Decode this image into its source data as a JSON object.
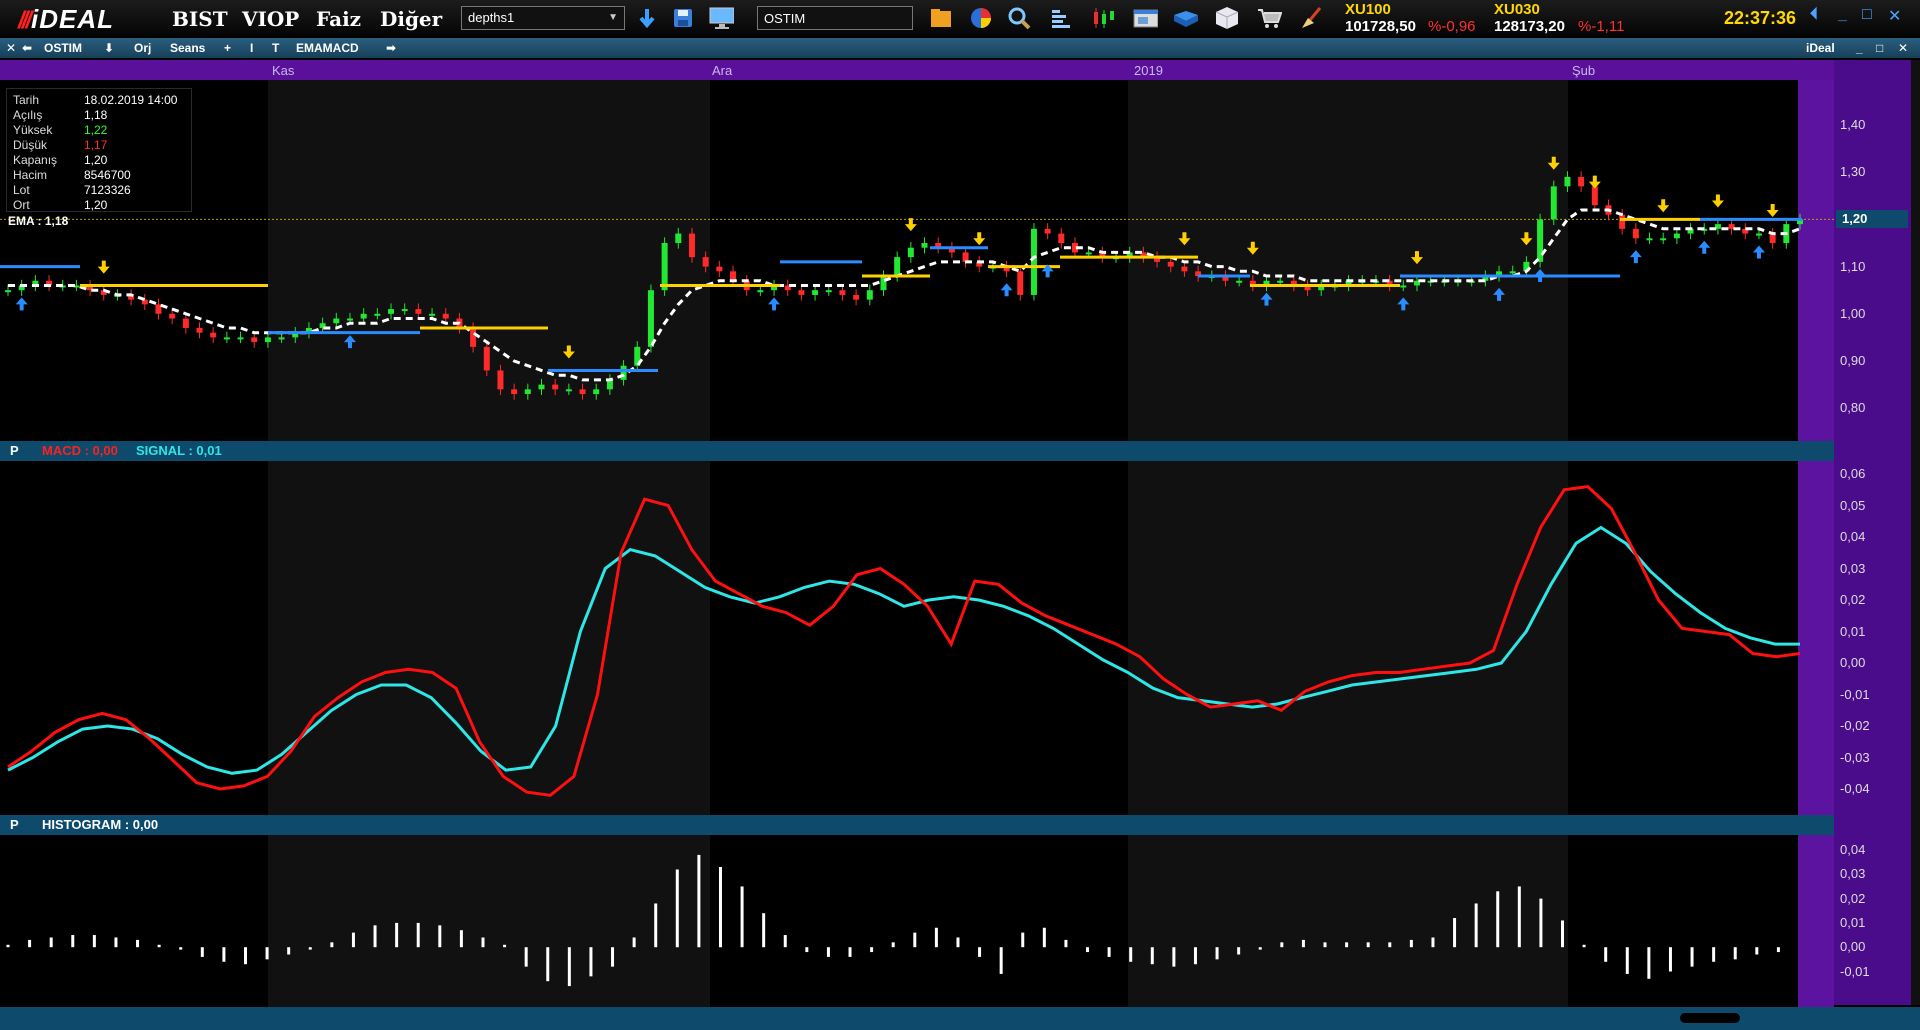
{
  "app": {
    "logo_text": "iDEAL",
    "menu": [
      "BIST",
      "VIOP",
      "Faiz",
      "Diğer"
    ],
    "depths_select": "depths1",
    "symbol_input": "OSTIM",
    "indices": [
      {
        "name": "XU100",
        "value": "101728,50",
        "change": "%-0,96"
      },
      {
        "name": "XU030",
        "value": "128173,20",
        "change": "%-1,11"
      }
    ],
    "clock": "22:37:36"
  },
  "chart_toolbar": {
    "symbol": "OSTIM",
    "orj": "Orj",
    "seans": "Seans",
    "plus": "+",
    "indicator": "EMAMACD",
    "brand": "iDeal"
  },
  "date_labels": [
    "Kas",
    "Ara",
    "2019",
    "Şub"
  ],
  "info_box": {
    "rows": [
      {
        "k": "Tarih",
        "v": "18.02.2019 14:00",
        "color": "#ffffff"
      },
      {
        "k": "Açılış",
        "v": "1,18",
        "color": "#ffffff"
      },
      {
        "k": "Yüksek",
        "v": "1,22",
        "color": "#2aff2a"
      },
      {
        "k": "Düşük",
        "v": "1,17",
        "color": "#ff3030"
      },
      {
        "k": "Kapanış",
        "v": "1,20",
        "color": "#ffffff"
      },
      {
        "k": "Hacim",
        "v": "8546700",
        "color": "#ffffff"
      },
      {
        "k": "Lot",
        "v": "7123326",
        "color": "#ffffff"
      },
      {
        "k": "Ort",
        "v": "1,20",
        "color": "#ffffff"
      }
    ],
    "ema_label": "EMA : 1,18"
  },
  "price_axis": [
    "1,40",
    "1,30",
    "1,20",
    "1,10",
    "1,00",
    "0,90",
    "0,80"
  ],
  "price_current": "1,20",
  "macd_panel": {
    "p": "P",
    "macd_label": "MACD : 0,00",
    "signal_label": "SIGNAL : 0,01",
    "axis": [
      "0,06",
      "0,05",
      "0,04",
      "0,03",
      "0,02",
      "0,01",
      "0,00",
      "-0,01",
      "-0,02",
      "-0,03",
      "-0,04"
    ]
  },
  "hist_panel": {
    "p": "P",
    "label": "HISTOGRAM : 0,00",
    "axis": [
      "0,04",
      "0,03",
      "0,02",
      "0,01",
      "0,00",
      "-0,01"
    ]
  },
  "colors": {
    "up": "#22e832",
    "down": "#ff2a2a",
    "ema": "#ffffff",
    "macd": "#ff1010",
    "signal": "#2ee6e6",
    "yellow": "#ffd000",
    "blue": "#2a8cff"
  },
  "chart_data": {
    "type": "line",
    "price": {
      "close": [
        1.05,
        1.06,
        1.07,
        1.06,
        1.06,
        1.06,
        1.05,
        1.04,
        1.04,
        1.03,
        1.02,
        1.0,
        0.99,
        0.97,
        0.96,
        0.95,
        0.95,
        0.95,
        0.94,
        0.95,
        0.95,
        0.96,
        0.97,
        0.98,
        0.99,
        0.99,
        1.0,
        1.0,
        1.01,
        1.01,
        1.0,
        1.0,
        0.99,
        0.97,
        0.93,
        0.88,
        0.84,
        0.83,
        0.84,
        0.85,
        0.84,
        0.84,
        0.83,
        0.84,
        0.86,
        0.89,
        0.93,
        1.05,
        1.15,
        1.17,
        1.12,
        1.1,
        1.09,
        1.07,
        1.05,
        1.05,
        1.06,
        1.05,
        1.04,
        1.05,
        1.05,
        1.04,
        1.03,
        1.05,
        1.08,
        1.12,
        1.14,
        1.15,
        1.14,
        1.13,
        1.11,
        1.1,
        1.1,
        1.09,
        1.04,
        1.18,
        1.17,
        1.15,
        1.13,
        1.13,
        1.12,
        1.12,
        1.13,
        1.12,
        1.11,
        1.1,
        1.09,
        1.08,
        1.08,
        1.07,
        1.07,
        1.06,
        1.07,
        1.07,
        1.06,
        1.05,
        1.06,
        1.06,
        1.07,
        1.07,
        1.07,
        1.06,
        1.06,
        1.07,
        1.07,
        1.07,
        1.07,
        1.07,
        1.08,
        1.09,
        1.09,
        1.11,
        1.2,
        1.27,
        1.29,
        1.27,
        1.23,
        1.21,
        1.18,
        1.16,
        1.16,
        1.16,
        1.17,
        1.18,
        1.18,
        1.19,
        1.18,
        1.17,
        1.17,
        1.15,
        1.19,
        1.2
      ],
      "ema": [
        1.06,
        1.06,
        1.06,
        1.06,
        1.06,
        1.06,
        1.05,
        1.05,
        1.04,
        1.04,
        1.03,
        1.02,
        1.01,
        1.0,
        0.99,
        0.98,
        0.97,
        0.97,
        0.96,
        0.96,
        0.96,
        0.96,
        0.96,
        0.97,
        0.97,
        0.98,
        0.98,
        0.98,
        0.99,
        0.99,
        0.99,
        0.99,
        0.98,
        0.98,
        0.96,
        0.94,
        0.92,
        0.9,
        0.89,
        0.88,
        0.87,
        0.87,
        0.86,
        0.86,
        0.86,
        0.87,
        0.89,
        0.93,
        0.98,
        1.02,
        1.05,
        1.06,
        1.07,
        1.07,
        1.07,
        1.07,
        1.06,
        1.06,
        1.06,
        1.06,
        1.06,
        1.06,
        1.06,
        1.06,
        1.07,
        1.08,
        1.09,
        1.1,
        1.11,
        1.11,
        1.11,
        1.11,
        1.11,
        1.1,
        1.09,
        1.12,
        1.13,
        1.14,
        1.14,
        1.14,
        1.13,
        1.13,
        1.13,
        1.13,
        1.12,
        1.12,
        1.11,
        1.11,
        1.1,
        1.1,
        1.09,
        1.09,
        1.08,
        1.08,
        1.08,
        1.07,
        1.07,
        1.07,
        1.07,
        1.07,
        1.07,
        1.07,
        1.07,
        1.07,
        1.07,
        1.07,
        1.07,
        1.07,
        1.07,
        1.08,
        1.08,
        1.09,
        1.12,
        1.16,
        1.2,
        1.22,
        1.22,
        1.22,
        1.21,
        1.2,
        1.19,
        1.18,
        1.18,
        1.18,
        1.18,
        1.18,
        1.18,
        1.18,
        1.18,
        1.17,
        1.17,
        1.18
      ]
    },
    "macd": {
      "values": [
        -0.033,
        -0.028,
        -0.022,
        -0.018,
        -0.016,
        -0.018,
        -0.024,
        -0.031,
        -0.038,
        -0.04,
        -0.039,
        -0.036,
        -0.028,
        -0.017,
        -0.011,
        -0.006,
        -0.003,
        -0.002,
        -0.003,
        -0.008,
        -0.025,
        -0.036,
        -0.041,
        -0.042,
        -0.036,
        -0.01,
        0.035,
        0.052,
        0.05,
        0.036,
        0.026,
        0.022,
        0.018,
        0.016,
        0.012,
        0.018,
        0.028,
        0.03,
        0.025,
        0.018,
        0.006,
        0.026,
        0.025,
        0.019,
        0.015,
        0.012,
        0.009,
        0.006,
        0.002,
        -0.005,
        -0.01,
        -0.014,
        -0.013,
        -0.012,
        -0.015,
        -0.009,
        -0.006,
        -0.004,
        -0.003,
        -0.003,
        -0.002,
        -0.001,
        0.0,
        0.004,
        0.025,
        0.043,
        0.055,
        0.056,
        0.049,
        0.035,
        0.02,
        0.011,
        0.01,
        0.009,
        0.003,
        0.002,
        0.003
      ],
      "signal": [
        -0.034,
        -0.03,
        -0.025,
        -0.021,
        -0.02,
        -0.021,
        -0.024,
        -0.029,
        -0.033,
        -0.035,
        -0.034,
        -0.029,
        -0.022,
        -0.015,
        -0.01,
        -0.007,
        -0.007,
        -0.011,
        -0.019,
        -0.028,
        -0.034,
        -0.033,
        -0.02,
        0.01,
        0.03,
        0.036,
        0.034,
        0.029,
        0.024,
        0.021,
        0.019,
        0.021,
        0.024,
        0.026,
        0.025,
        0.022,
        0.018,
        0.02,
        0.021,
        0.02,
        0.018,
        0.015,
        0.011,
        0.006,
        0.001,
        -0.003,
        -0.008,
        -0.011,
        -0.012,
        -0.013,
        -0.014,
        -0.013,
        -0.011,
        -0.009,
        -0.007,
        -0.006,
        -0.005,
        -0.004,
        -0.003,
        -0.002,
        0.0,
        0.01,
        0.025,
        0.038,
        0.043,
        0.038,
        0.029,
        0.022,
        0.016,
        0.011,
        0.008,
        0.006,
        0.006
      ]
    },
    "histogram": {
      "values": [
        0.001,
        0.003,
        0.004,
        0.005,
        0.005,
        0.004,
        0.003,
        0.001,
        -0.001,
        -0.004,
        -0.006,
        -0.007,
        -0.005,
        -0.003,
        -0.001,
        0.002,
        0.006,
        0.009,
        0.01,
        0.01,
        0.009,
        0.007,
        0.004,
        0.001,
        -0.008,
        -0.014,
        -0.016,
        -0.012,
        -0.008,
        0.004,
        0.018,
        0.032,
        0.038,
        0.033,
        0.025,
        0.014,
        0.005,
        -0.002,
        -0.004,
        -0.004,
        -0.002,
        0.002,
        0.006,
        0.008,
        0.004,
        -0.004,
        -0.011,
        0.006,
        0.008,
        0.003,
        -0.002,
        -0.004,
        -0.006,
        -0.007,
        -0.008,
        -0.007,
        -0.005,
        -0.003,
        -0.001,
        0.002,
        0.003,
        0.002,
        0.002,
        0.002,
        0.002,
        0.003,
        0.004,
        0.012,
        0.018,
        0.023,
        0.025,
        0.02,
        0.011,
        0.001,
        -0.006,
        -0.011,
        -0.013,
        -0.01,
        -0.008,
        -0.006,
        -0.005,
        -0.003,
        -0.002,
        0.0
      ]
    }
  }
}
